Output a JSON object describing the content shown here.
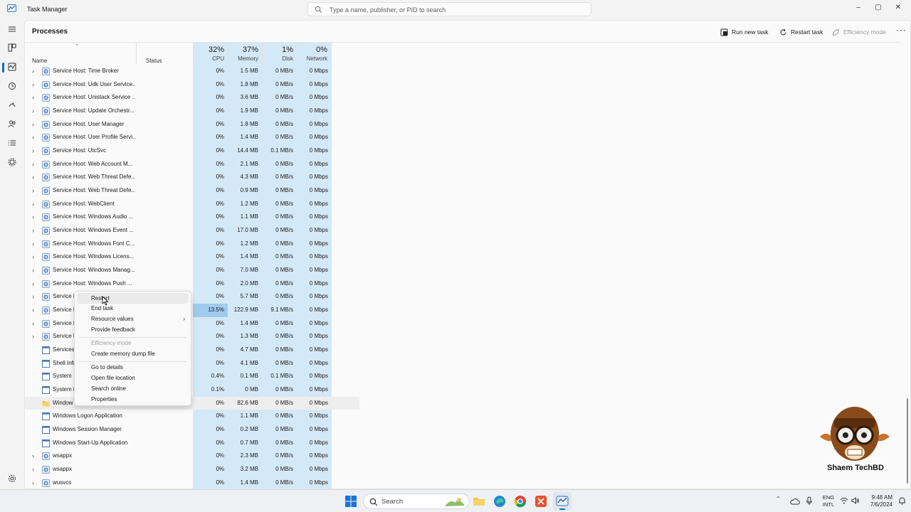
{
  "app": {
    "title": "Task Manager"
  },
  "search": {
    "placeholder": "Type a name, publisher, or PID to search"
  },
  "window_controls": {
    "minimize": "–",
    "maximize": "▢",
    "close": "✕"
  },
  "page": {
    "title": "Processes"
  },
  "toolbar": {
    "run_new_task": "Run new task",
    "restart_task": "Restart task",
    "efficiency_mode": "Efficiency mode",
    "more": "···"
  },
  "columns": {
    "name": "Name",
    "status": "Status",
    "cpu": {
      "pct": "32%",
      "label": "CPU"
    },
    "memory": {
      "pct": "37%",
      "label": "Memory"
    },
    "disk": {
      "pct": "1%",
      "label": "Disk"
    },
    "network": {
      "pct": "0%",
      "label": "Network"
    }
  },
  "processes": [
    {
      "name": "Service Host: Time Broker",
      "expandable": true,
      "icon": "gear-icon",
      "cpu": "0%",
      "memory": "1.5 MB",
      "disk": "0 MB/s",
      "network": "0 Mbps"
    },
    {
      "name": "Service Host: Udk User Service...",
      "expandable": true,
      "icon": "gear-icon",
      "cpu": "0%",
      "memory": "1.8 MB",
      "disk": "0 MB/s",
      "network": "0 Mbps"
    },
    {
      "name": "Service Host: Unistack Service ...",
      "expandable": true,
      "icon": "gear-icon",
      "cpu": "0%",
      "memory": "3.6 MB",
      "disk": "0 MB/s",
      "network": "0 Mbps"
    },
    {
      "name": "Service Host: Update Orchestr...",
      "expandable": true,
      "icon": "gear-icon",
      "cpu": "0%",
      "memory": "1.9 MB",
      "disk": "0 MB/s",
      "network": "0 Mbps"
    },
    {
      "name": "Service Host: User Manager",
      "expandable": true,
      "icon": "gear-icon",
      "cpu": "0%",
      "memory": "1.8 MB",
      "disk": "0 MB/s",
      "network": "0 Mbps"
    },
    {
      "name": "Service Host: User Profile Servi...",
      "expandable": true,
      "icon": "gear-icon",
      "cpu": "0%",
      "memory": "1.4 MB",
      "disk": "0 MB/s",
      "network": "0 Mbps"
    },
    {
      "name": "Service Host: UtcSvc",
      "expandable": true,
      "icon": "gear-icon",
      "cpu": "0%",
      "memory": "14.4 MB",
      "disk": "0.1 MB/s",
      "network": "0 Mbps"
    },
    {
      "name": "Service Host: Web Account M...",
      "expandable": true,
      "icon": "gear-icon",
      "cpu": "0%",
      "memory": "2.1 MB",
      "disk": "0 MB/s",
      "network": "0 Mbps"
    },
    {
      "name": "Service Host: Web Threat Defe...",
      "expandable": true,
      "icon": "gear-icon",
      "cpu": "0%",
      "memory": "4.3 MB",
      "disk": "0 MB/s",
      "network": "0 Mbps"
    },
    {
      "name": "Service Host: Web Threat Defe...",
      "expandable": true,
      "icon": "gear-icon",
      "cpu": "0%",
      "memory": "0.9 MB",
      "disk": "0 MB/s",
      "network": "0 Mbps"
    },
    {
      "name": "Service Host: WebClient",
      "expandable": true,
      "icon": "gear-icon",
      "cpu": "0%",
      "memory": "1.2 MB",
      "disk": "0 MB/s",
      "network": "0 Mbps"
    },
    {
      "name": "Service Host: Windows Audio ...",
      "expandable": true,
      "icon": "gear-icon",
      "cpu": "0%",
      "memory": "1.1 MB",
      "disk": "0 MB/s",
      "network": "0 Mbps"
    },
    {
      "name": "Service Host: Windows Event ...",
      "expandable": true,
      "icon": "gear-icon",
      "cpu": "0%",
      "memory": "17.0 MB",
      "disk": "0 MB/s",
      "network": "0 Mbps"
    },
    {
      "name": "Service Host: Windows Font C...",
      "expandable": true,
      "icon": "gear-icon",
      "cpu": "0%",
      "memory": "1.2 MB",
      "disk": "0 MB/s",
      "network": "0 Mbps"
    },
    {
      "name": "Service Host: Windows Licens...",
      "expandable": true,
      "icon": "gear-icon",
      "cpu": "0%",
      "memory": "1.4 MB",
      "disk": "0 MB/s",
      "network": "0 Mbps"
    },
    {
      "name": "Service Host: Windows Manag...",
      "expandable": true,
      "icon": "gear-icon",
      "cpu": "0%",
      "memory": "7.0 MB",
      "disk": "0 MB/s",
      "network": "0 Mbps"
    },
    {
      "name": "Service Host: Windows Push ...",
      "expandable": true,
      "icon": "gear-icon",
      "cpu": "0%",
      "memory": "2.0 MB",
      "disk": "0 MB/s",
      "network": "0 Mbps"
    },
    {
      "name": "Service H",
      "expandable": true,
      "icon": "gear-icon",
      "cpu": "0%",
      "memory": "5.7 MB",
      "disk": "0 MB/s",
      "network": "0 Mbps"
    },
    {
      "name": "Service H",
      "expandable": true,
      "icon": "gear-icon",
      "cpu": "13.5%",
      "memory": "122.9 MB",
      "disk": "9.1 MB/s",
      "network": "0 Mbps",
      "highlight": true
    },
    {
      "name": "Service H",
      "expandable": true,
      "icon": "gear-icon",
      "cpu": "0%",
      "memory": "1.4 MB",
      "disk": "0 MB/s",
      "network": "0 Mbps"
    },
    {
      "name": "Service H",
      "expandable": true,
      "icon": "gear-icon",
      "cpu": "0%",
      "memory": "1.3 MB",
      "disk": "0 MB/s",
      "network": "0 Mbps"
    },
    {
      "name": "Services",
      "expandable": false,
      "icon": "window-icon",
      "cpu": "0%",
      "memory": "4.7 MB",
      "disk": "0 MB/s",
      "network": "0 Mbps"
    },
    {
      "name": "Shell Infr",
      "expandable": false,
      "icon": "window-icon",
      "cpu": "0%",
      "memory": "4.1 MB",
      "disk": "0 MB/s",
      "network": "0 Mbps"
    },
    {
      "name": "System",
      "expandable": false,
      "icon": "window-icon",
      "cpu": "0.4%",
      "memory": "0.1 MB",
      "disk": "0.1 MB/s",
      "network": "0 Mbps"
    },
    {
      "name": "System i",
      "expandable": false,
      "icon": "window-icon",
      "cpu": "0.1%",
      "memory": "0 MB",
      "disk": "0 MB/s",
      "network": "0 Mbps"
    },
    {
      "name": "Window",
      "expandable": false,
      "icon": "folder-icon",
      "cpu": "0%",
      "memory": "82.6 MB",
      "disk": "0 MB/s",
      "network": "0 Mbps",
      "selected": true
    },
    {
      "name": "Windows Logon Application",
      "expandable": false,
      "icon": "window-icon",
      "cpu": "0%",
      "memory": "1.1 MB",
      "disk": "0 MB/s",
      "network": "0 Mbps"
    },
    {
      "name": "Windows Session Manager",
      "expandable": false,
      "icon": "window-icon",
      "cpu": "0%",
      "memory": "0.2 MB",
      "disk": "0 MB/s",
      "network": "0 Mbps"
    },
    {
      "name": "Windows Start-Up Application",
      "expandable": false,
      "icon": "window-icon",
      "cpu": "0%",
      "memory": "0.7 MB",
      "disk": "0 MB/s",
      "network": "0 Mbps"
    },
    {
      "name": "wsappx",
      "expandable": true,
      "icon": "gear-icon",
      "cpu": "0%",
      "memory": "2.3 MB",
      "disk": "0 MB/s",
      "network": "0 Mbps"
    },
    {
      "name": "wsappx",
      "expandable": true,
      "icon": "gear-icon",
      "cpu": "0%",
      "memory": "3.2 MB",
      "disk": "0 MB/s",
      "network": "0 Mbps"
    },
    {
      "name": "wusvcs",
      "expandable": true,
      "icon": "gear-icon",
      "cpu": "0%",
      "memory": "1.4 MB",
      "disk": "0 MB/s",
      "network": "0 Mbps"
    }
  ],
  "context_menu": {
    "restart": "Restart",
    "end_task": "End task",
    "resource_values": "Resource values",
    "provide_feedback": "Provide feedback",
    "efficiency_mode": "Efficiency mode",
    "create_dump": "Create memory dump file",
    "go_to_details": "Go to details",
    "open_file_location": "Open file location",
    "search_online": "Search online",
    "properties": "Properties"
  },
  "taskbar": {
    "search_label": "Search",
    "language": {
      "line1": "ENG",
      "line2": "INTL"
    },
    "time": "9:48 AM",
    "date": "7/6/2024"
  },
  "watermark": {
    "text": "Shaem TechBD"
  },
  "colors": {
    "accent": "#0f6cbd",
    "heat_light": "#d4e9f7",
    "heat_strong": "#9fcbee"
  }
}
